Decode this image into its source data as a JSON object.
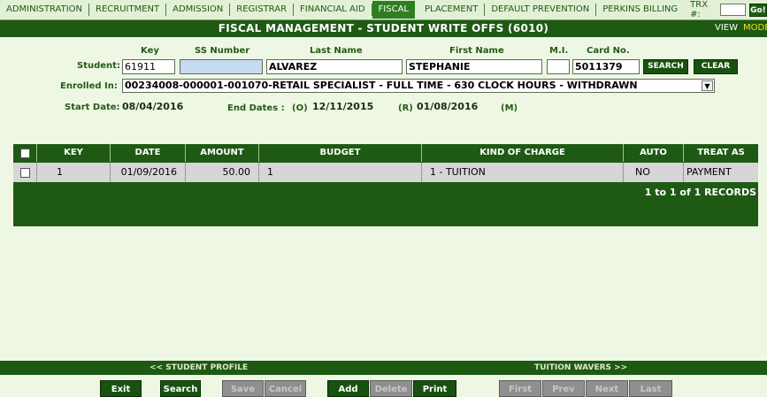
{
  "nav": {
    "items": [
      "ADMINISTRATION",
      "RECRUITMENT",
      "ADMISSION",
      "REGISTRAR",
      "FINANCIAL AID",
      "FISCAL",
      "PLACEMENT",
      "DEFAULT PREVENTION",
      "PERKINS BILLING"
    ],
    "active": "FISCAL",
    "trx_label": "TRX #:",
    "trx_value": "",
    "go_label": "Go!"
  },
  "header": {
    "title": "FISCAL MANAGEMENT - STUDENT WRITE OFFS (6010)",
    "view_label": "VIEW",
    "mode_label": "MODE"
  },
  "student": {
    "label": "Student:",
    "col_key": "Key",
    "col_ssn": "SS Number",
    "col_last": "Last Name",
    "col_first": "First Name",
    "col_mi": "M.I.",
    "col_card": "Card No.",
    "key": "61911",
    "ssn": "",
    "last_name": "ALVAREZ",
    "first_name": "STEPHANIE",
    "mi": "",
    "card_no": "5011379",
    "search_label": "SEARCH",
    "clear_label": "CLEAR"
  },
  "enrollment": {
    "label": "Enrolled In:",
    "selected": "00234008-000001-001070-RETAIL SPECIALIST - FULL TIME - 630 CLOCK HOURS - WITHDRAWN",
    "start_label": "Start Date:",
    "start_date": "08/04/2016",
    "end_label": "End Dates :",
    "o_label": "(O)",
    "o_date": "12/11/2015",
    "r_label": "(R)",
    "r_date": "01/08/2016",
    "m_label": "(M)"
  },
  "table": {
    "headers": [
      "KEY",
      "DATE",
      "AMOUNT",
      "BUDGET",
      "KIND OF CHARGE",
      "AUTO",
      "TREAT AS"
    ],
    "rows": [
      {
        "key": "1",
        "date": "01/09/2016",
        "amount": "50.00",
        "budget": "1",
        "kind": "1 - TUITION",
        "auto": "NO",
        "treat_as": "PAYMENT"
      }
    ],
    "records_text": "1 to 1 of 1 RECORDS"
  },
  "links": {
    "left": "<< STUDENT PROFILE",
    "right": "TUITION WAVERS >>"
  },
  "actions": {
    "exit": "Exit",
    "search": "Search",
    "save": "Save",
    "cancel": "Cancel",
    "add": "Add",
    "delete": "Delete",
    "print": "Print",
    "first": "First",
    "prev": "Prev",
    "next": "Next",
    "last": "Last"
  },
  "colors": {
    "dark_green": "#1e5a14",
    "accent_yellow": "#f0e21a",
    "page_bg": "#eef7e4"
  }
}
